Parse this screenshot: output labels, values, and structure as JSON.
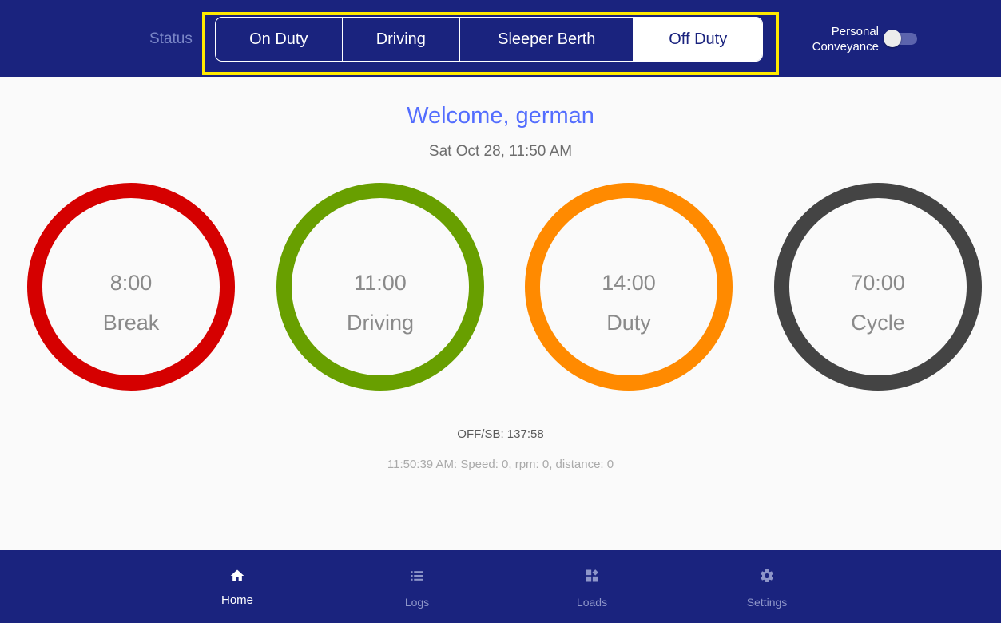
{
  "header": {
    "status_label": "Status",
    "status_options": [
      {
        "label": "On Duty",
        "active": false
      },
      {
        "label": "Driving",
        "active": false
      },
      {
        "label": "Sleeper Berth",
        "active": false
      },
      {
        "label": "Off Duty",
        "active": true
      }
    ],
    "personal_conveyance": {
      "label_line1": "Personal",
      "label_line2": "Conveyance",
      "enabled": false
    }
  },
  "main": {
    "welcome": "Welcome, german",
    "datetime": "Sat Oct 28, 11:50 AM",
    "clocks": [
      {
        "time": "8:00",
        "label": "Break",
        "color": "#d50000"
      },
      {
        "time": "11:00",
        "label": "Driving",
        "color": "#689f00"
      },
      {
        "time": "14:00",
        "label": "Duty",
        "color": "#ff8a00"
      },
      {
        "time": "70:00",
        "label": "Cycle",
        "color": "#444444"
      }
    ],
    "off_sb": "OFF/SB: 137:58",
    "telemetry": "11:50:39 AM: Speed: 0, rpm: 0, distance: 0"
  },
  "nav": {
    "items": [
      {
        "label": "Home",
        "icon": "home-icon",
        "active": true
      },
      {
        "label": "Logs",
        "icon": "list-icon",
        "active": false
      },
      {
        "label": "Loads",
        "icon": "dashboard-icon",
        "active": false
      },
      {
        "label": "Settings",
        "icon": "gear-icon",
        "active": false
      }
    ]
  },
  "colors": {
    "bar_background": "#1a237e",
    "highlight": "#ffea00",
    "welcome_text": "#536dfe"
  }
}
